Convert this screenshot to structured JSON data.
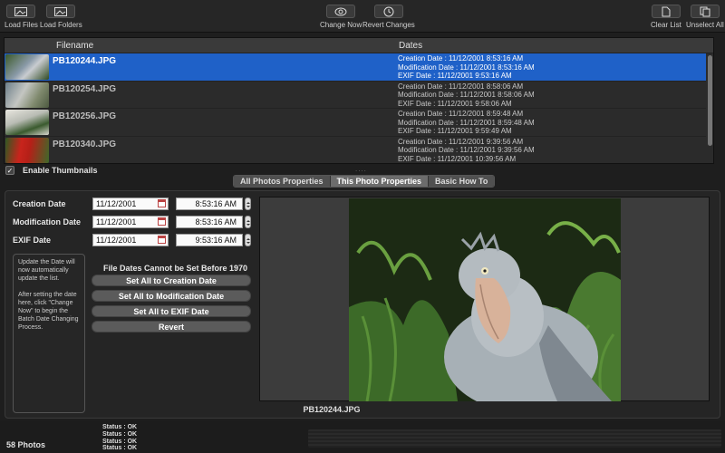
{
  "toolbar": {
    "load_files": "Load Files",
    "load_folders": "Load Folders",
    "change_now": "Change Now",
    "revert_changes": "Revert Changes",
    "clear_list": "Clear List",
    "unselect_all": "Unselect All"
  },
  "list": {
    "col_filename": "Filename",
    "col_dates": "Dates",
    "rows": [
      {
        "filename": "PB120244.JPG",
        "creation": "Creation Date : 11/12/2001 8:53:16 AM",
        "modification": "Modification Date : 11/12/2001 8:53:16 AM",
        "exif": "EXIF Date : 11/12/2001 9:53:16 AM"
      },
      {
        "filename": "PB120254.JPG",
        "creation": "Creation Date : 11/12/2001 8:58:06 AM",
        "modification": "Modification Date : 11/12/2001 8:58:06 AM",
        "exif": "EXIF Date : 11/12/2001 9:58:06 AM"
      },
      {
        "filename": "PB120256.JPG",
        "creation": "Creation Date : 11/12/2001 8:59:48 AM",
        "modification": "Modification Date : 11/12/2001 8:59:48 AM",
        "exif": "EXIF Date : 11/12/2001 9:59:49 AM"
      },
      {
        "filename": "PB120340.JPG",
        "creation": "Creation Date : 11/12/2001 9:39:56 AM",
        "modification": "Modification Date : 11/12/2001 9:39:56 AM",
        "exif": "EXIF Date : 11/12/2001 10:39:56 AM"
      }
    ]
  },
  "enable_thumbnails": "Enable Thumbnails",
  "splitter": "....",
  "tabs": {
    "all_props": "All Photos Properties",
    "this_props": "This Photo Properties",
    "how_to": "Basic How To"
  },
  "props": {
    "creation_label": "Creation Date",
    "creation_date": "11/12/2001",
    "creation_time": "8:53:16 AM",
    "modification_label": "Modification Date",
    "modification_date": "11/12/2001",
    "modification_time": "8:53:16 AM",
    "exif_label": "EXIF Date",
    "exif_date": "11/12/2001",
    "exif_time": "9:53:16 AM",
    "note_1": "Update the Date will now automatically update the list.",
    "note_2": "After setting the date here, click \"Change Now\" to begin the Batch Date Changing Process.",
    "warning": "File Dates Cannot be Set Before 1970",
    "btn_creation": "Set All to Creation Date",
    "btn_modification": "Set All to Modification Date",
    "btn_exif": "Set All to EXIF Date",
    "btn_revert": "Revert"
  },
  "preview": {
    "filename": "PB120244.JPG"
  },
  "status": {
    "count": "58 Photos",
    "lines": [
      "Status : OK",
      "Status : OK",
      "Status : OK",
      "Status : OK"
    ]
  },
  "colors": {
    "selection": "#1f61c8",
    "background": "#1e1e1e"
  }
}
